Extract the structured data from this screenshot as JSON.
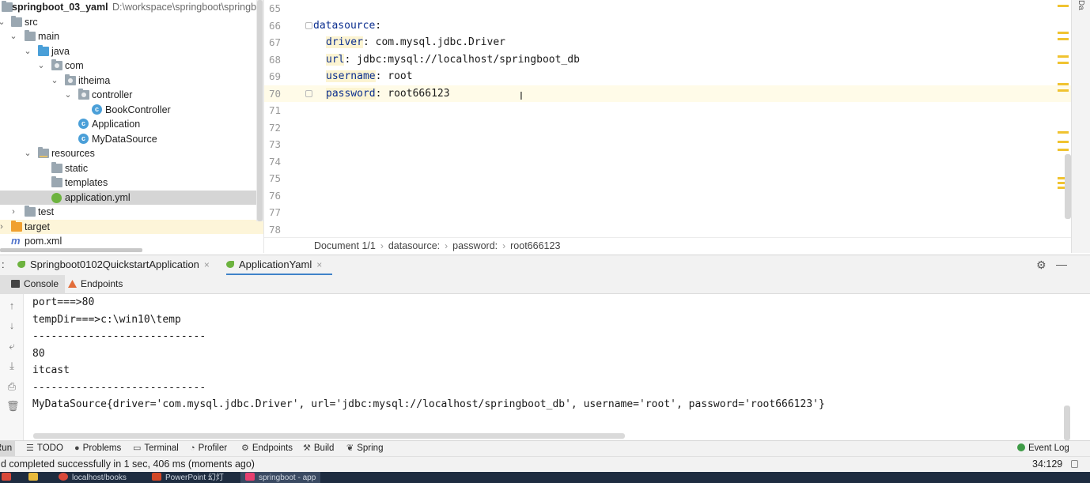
{
  "project": {
    "name": "springboot_03_yaml",
    "path": "D:\\workspace\\springboot\\springb",
    "tree": [
      {
        "label": "src"
      },
      {
        "label": "main"
      },
      {
        "label": "java"
      },
      {
        "label": "com"
      },
      {
        "label": "itheima"
      },
      {
        "label": "controller"
      },
      {
        "label": "BookController"
      },
      {
        "label": "Application"
      },
      {
        "label": "MyDataSource"
      },
      {
        "label": "resources"
      },
      {
        "label": "static"
      },
      {
        "label": "templates"
      },
      {
        "label": "application.yml"
      },
      {
        "label": "test"
      },
      {
        "label": "target"
      },
      {
        "label": "pom.xml"
      }
    ]
  },
  "editor": {
    "lines": [
      {
        "num": "65",
        "key": "",
        "sep": "",
        "value": ""
      },
      {
        "num": "66",
        "key": "datasource",
        "sep": ":",
        "value": ""
      },
      {
        "num": "67",
        "key": "driver",
        "sep": ": ",
        "value": "com.mysql.jdbc.Driver"
      },
      {
        "num": "68",
        "key": "url",
        "sep": ": ",
        "value": "jdbc:mysql://localhost/springboot_db"
      },
      {
        "num": "69",
        "key": "username",
        "sep": ": ",
        "value": "root"
      },
      {
        "num": "70",
        "key": "password",
        "sep": ": ",
        "value": "root666123"
      },
      {
        "num": "71"
      },
      {
        "num": "72"
      },
      {
        "num": "73"
      },
      {
        "num": "74"
      },
      {
        "num": "75"
      },
      {
        "num": "76"
      },
      {
        "num": "77"
      },
      {
        "num": "78"
      }
    ],
    "breadcrumb": [
      "Document 1/1",
      "datasource:",
      "password:",
      "root666123"
    ],
    "caret_glyph": "I",
    "right_strip_label": "Da"
  },
  "run": {
    "prefix": ":",
    "tabs": [
      {
        "label": "Springboot0102QuickstartApplication",
        "close": "×"
      },
      {
        "label": "ApplicationYaml",
        "close": "×"
      }
    ],
    "subtabs": [
      "Console",
      "Endpoints"
    ],
    "console_lines": [
      "port===>80",
      "tempDir===>c:\\win10\\temp",
      "----------------------------",
      "80",
      "itcast",
      "----------------------------",
      "MyDataSource{driver='com.mysql.jdbc.Driver', url='jdbc:mysql://localhost/springboot_db', username='root', password='root666123'}"
    ]
  },
  "toolwindows": [
    {
      "label": "Run",
      "icon": "▶"
    },
    {
      "label": "TODO",
      "icon": "☰"
    },
    {
      "label": "Problems",
      "icon": "●"
    },
    {
      "label": "Terminal",
      "icon": "▭"
    },
    {
      "label": "Profiler",
      "icon": "◔"
    },
    {
      "label": "Endpoints",
      "icon": "⚙"
    },
    {
      "label": "Build",
      "icon": "⚒"
    },
    {
      "label": "Spring",
      "icon": "❦"
    }
  ],
  "event_log": "Event Log",
  "status": {
    "message": "d completed successfully in 1 sec, 406 ms (moments ago)",
    "position": "34:129"
  },
  "taskbar": [
    {
      "label": "localhost/books",
      "color": "#d9493a"
    },
    {
      "label": "PowerPoint 幻灯",
      "color": "#d24726"
    },
    {
      "label": "springboot - app",
      "color": "#e83f6f"
    }
  ],
  "colors": {
    "accent": "#4083c9",
    "yaml_key": "#0b2e8f",
    "current_line": "#fffbe8"
  }
}
